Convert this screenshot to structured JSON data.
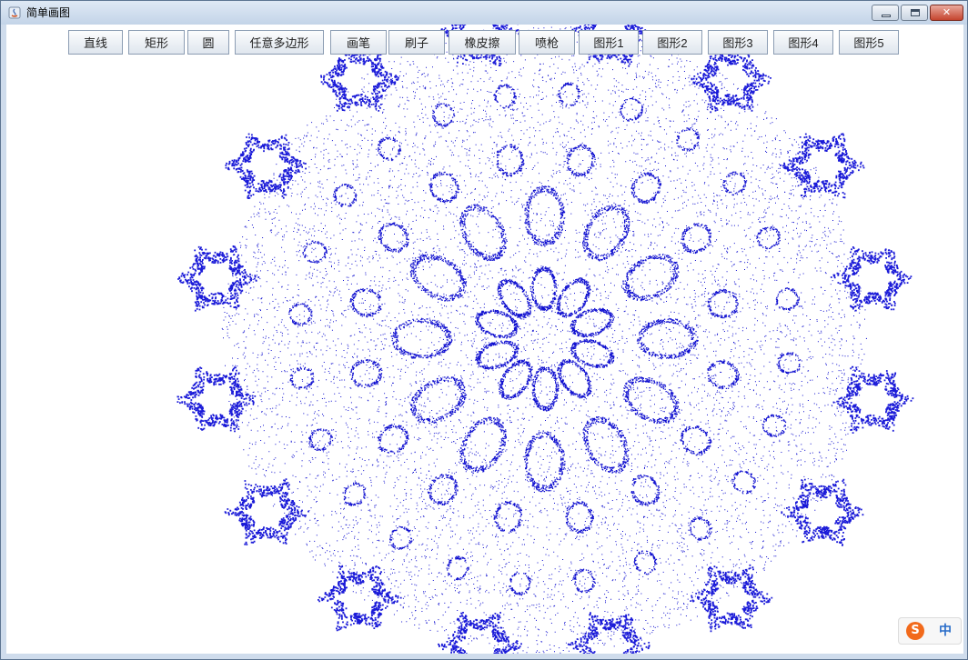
{
  "window": {
    "title": "简单画图",
    "controls": {
      "minimize": "minimize-icon",
      "maximize": "maximize-icon",
      "close": "close-icon"
    }
  },
  "toolbar": {
    "buttons": [
      "直线",
      "矩形",
      "圆",
      "任意多边形",
      "画笔",
      "刷子",
      "橡皮擦",
      "喷枪",
      "图形1",
      "图形2",
      "图形3",
      "图形4",
      "图形5"
    ]
  },
  "ime": {
    "logo": "S",
    "mode": "中"
  },
  "drawing": {
    "color": "#1010d0",
    "dense_color": "#1a1ad8",
    "background": "#ffffff"
  }
}
